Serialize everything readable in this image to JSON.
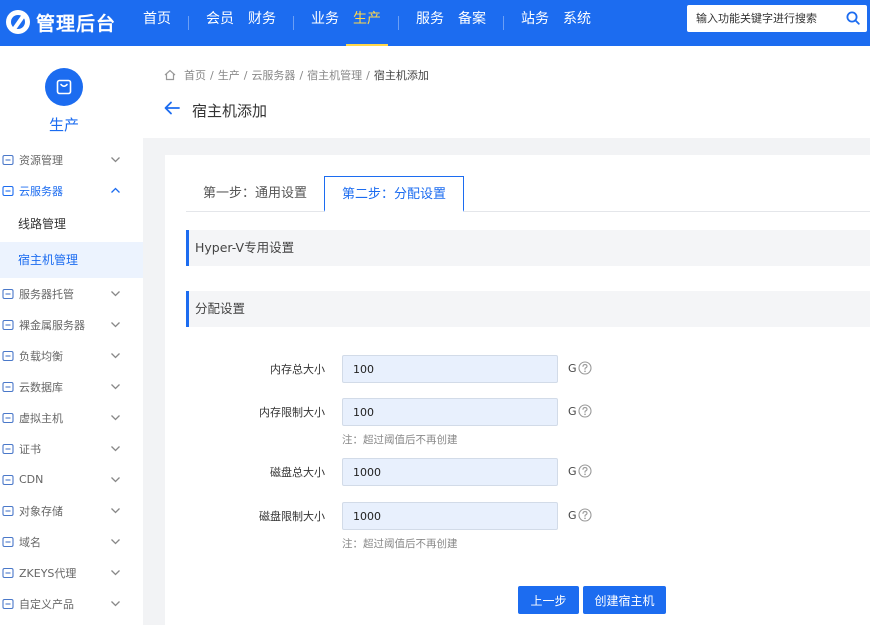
{
  "topbar": {
    "logo_text": "管理后台",
    "nav_groups": [
      [
        {
          "label": "首页",
          "active": false
        }
      ],
      [
        {
          "label": "会员",
          "active": false
        },
        {
          "label": "财务",
          "active": false
        }
      ],
      [
        {
          "label": "业务",
          "active": false
        },
        {
          "label": "生产",
          "active": true
        }
      ],
      [
        {
          "label": "服务",
          "active": false
        },
        {
          "label": "备案",
          "active": false
        }
      ],
      [
        {
          "label": "站务",
          "active": false
        },
        {
          "label": "系统",
          "active": false
        }
      ]
    ],
    "search_placeholder": "输入功能关键字进行搜索",
    "search_icon": "search-icon"
  },
  "sidebar": {
    "title": "生产",
    "badge_icon": "bag-icon",
    "items": [
      {
        "label": "资源管理",
        "icon": "resource-icon",
        "expanded": false
      },
      {
        "label": "云服务器",
        "icon": "cloud-icon",
        "expanded": true,
        "children": [
          {
            "label": "线路管理",
            "active": false
          },
          {
            "label": "宿主机管理",
            "active": true
          }
        ]
      },
      {
        "label": "服务器托管",
        "icon": "server-icon",
        "expanded": false
      },
      {
        "label": "裸金属服务器",
        "icon": "server-stack-icon",
        "expanded": false
      },
      {
        "label": "负载均衡",
        "icon": "load-balancer-icon",
        "expanded": false
      },
      {
        "label": "云数据库",
        "icon": "database-icon",
        "expanded": false
      },
      {
        "label": "虚拟主机",
        "icon": "virtual-host-icon",
        "expanded": false
      },
      {
        "label": "证书",
        "icon": "certificate-icon",
        "expanded": false
      },
      {
        "label": "CDN",
        "icon": "cdn-icon",
        "expanded": false
      },
      {
        "label": "对象存储",
        "icon": "storage-icon",
        "expanded": false
      },
      {
        "label": "域名",
        "icon": "globe-icon",
        "expanded": false
      },
      {
        "label": "ZKEYS代理",
        "icon": "agent-icon",
        "expanded": false
      },
      {
        "label": "自定义产品",
        "icon": "custom-product-icon",
        "expanded": false
      }
    ]
  },
  "breadcrumb": [
    "首页",
    "生产",
    "云服务器",
    "宿主机管理",
    "宿主机添加"
  ],
  "page_title": "宿主机添加",
  "tabs": [
    {
      "label": "第一步：通用设置",
      "active": false
    },
    {
      "label": "第二步：分配设置",
      "active": true
    }
  ],
  "sections": {
    "hyperv": "Hyper-V专用设置",
    "allocation": "分配设置"
  },
  "form": [
    {
      "label": "内存总大小",
      "value": "100",
      "unit": "G",
      "note": ""
    },
    {
      "label": "内存限制大小",
      "value": "100",
      "unit": "G",
      "note": "注：超过阈值后不再创建"
    },
    {
      "label": "磁盘总大小",
      "value": "1000",
      "unit": "G",
      "note": ""
    },
    {
      "label": "磁盘限制大小",
      "value": "1000",
      "unit": "G",
      "note": "注：超过阈值后不再创建"
    }
  ],
  "buttons": {
    "prev": "上一步",
    "create": "创建宿主机"
  },
  "colors": {
    "primary": "#1c6cf0",
    "active_nav": "#ffd84a",
    "input_bg": "#e8f0fd",
    "active_sub_bg": "#ecf3fe"
  }
}
